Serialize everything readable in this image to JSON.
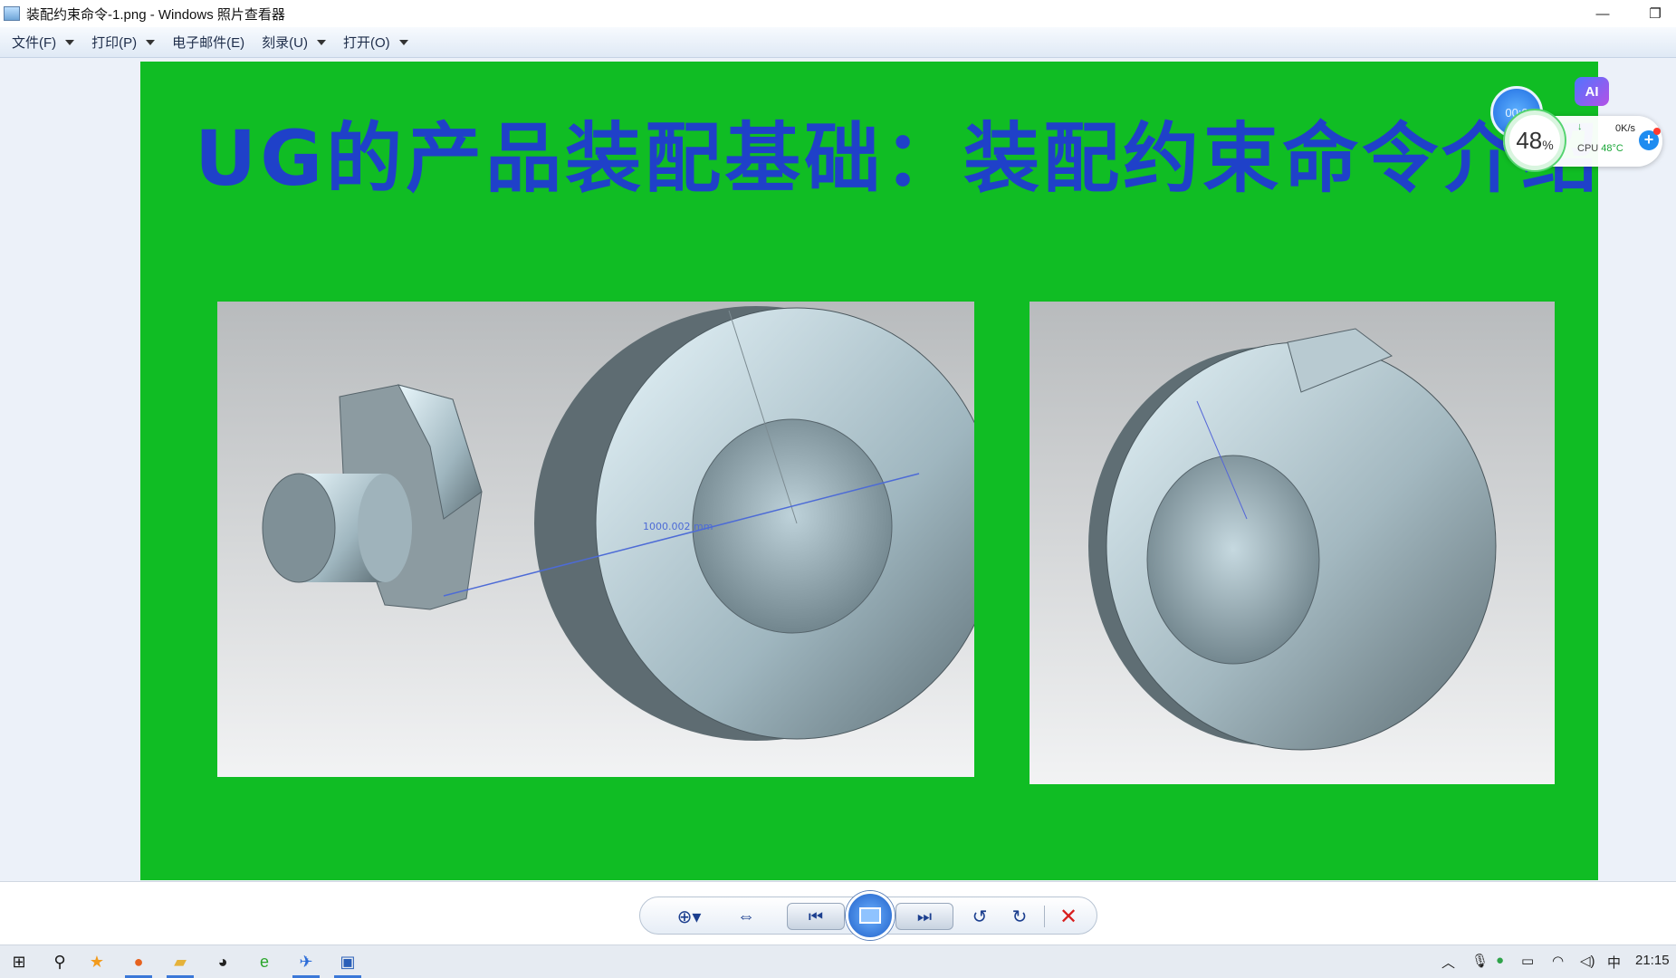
{
  "window": {
    "title": "装配约束命令-1.png - Windows 照片查看器",
    "minimize_glyph": "—",
    "restore_glyph": "❐"
  },
  "menu": [
    {
      "label": "文件(F)",
      "has_dropdown": true
    },
    {
      "label": "打印(P)",
      "has_dropdown": true
    },
    {
      "label": "电子邮件(E)",
      "has_dropdown": false
    },
    {
      "label": "刻录(U)",
      "has_dropdown": true
    },
    {
      "label": "打开(O)",
      "has_dropdown": true
    }
  ],
  "slide": {
    "title": "UG的产品装配基础：装配约束命令介绍",
    "measurement_label": "1000.002 mm",
    "background_color": "#10bd24",
    "title_color": "#1f41c9"
  },
  "widgets": {
    "ai_label": "AI",
    "timer": "00:0",
    "cpu_usage": "48",
    "cpu_usage_unit": "%",
    "net_speed": "0K/s",
    "cpu_label": "CPU",
    "cpu_temp": "48°C"
  },
  "toolbar": {
    "buttons": [
      "zoom-icon",
      "fit-actual-size-icon",
      "previous-icon",
      "slideshow-icon",
      "next-icon",
      "rotate-ccw-icon",
      "rotate-cw-icon",
      "delete-icon"
    ]
  },
  "taskbar": {
    "apps": [
      "start-icon",
      "search-icon",
      "star-app-icon",
      "firefox-icon",
      "file-explorer-icon",
      "qq-icon",
      "edge-icon",
      "bird-app-icon",
      "photo-viewer-icon"
    ],
    "ime": "中",
    "time": "21:15"
  }
}
